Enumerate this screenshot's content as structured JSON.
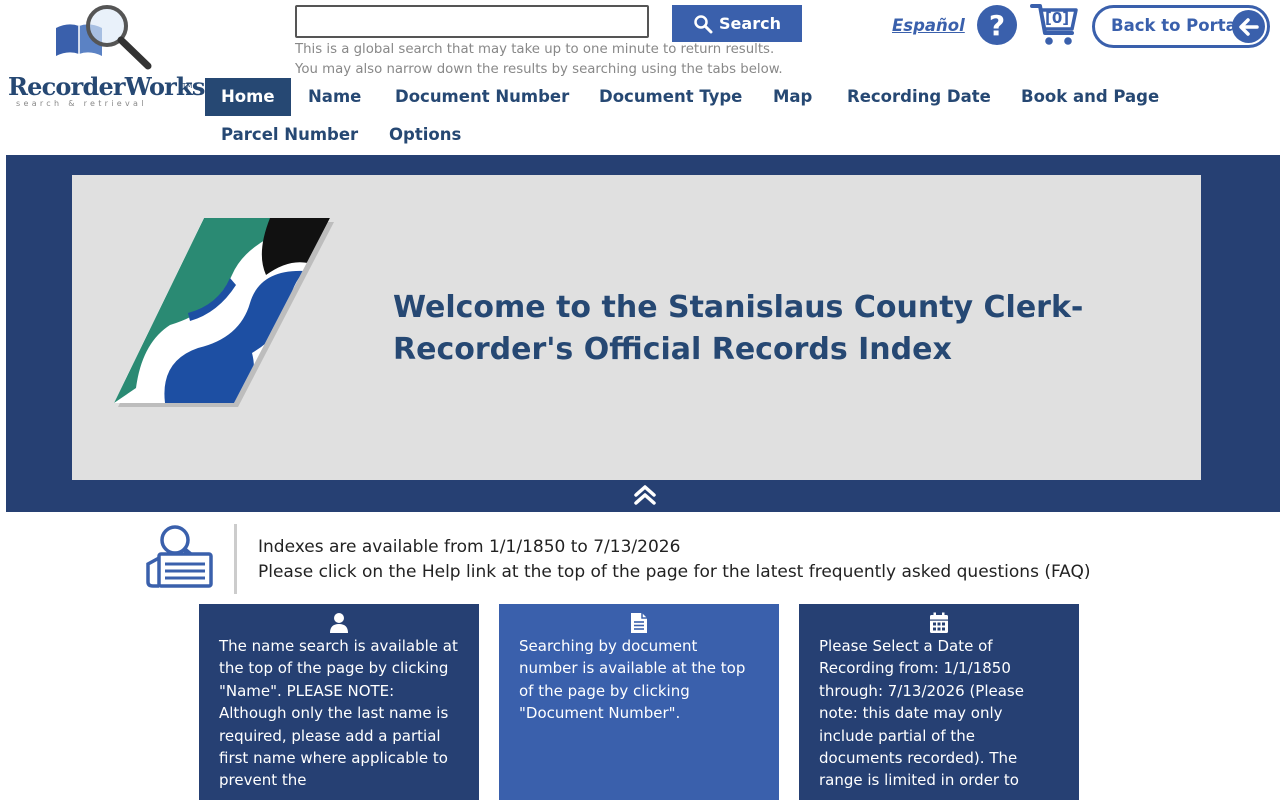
{
  "header": {
    "logo_text": "RecorderWorks",
    "logo_tm": "TM",
    "logo_tagline": "search & retrieval",
    "search_placeholder": "",
    "search_button": "Search",
    "search_hint_line1": "This is a global search that may take up to one minute to return results.",
    "search_hint_line2": "You may also narrow down the results by searching using the tabs below.",
    "language_link": "Español",
    "help_icon": "question-icon",
    "cart_count": "[0]",
    "portal_button": "Back to Portal"
  },
  "nav": {
    "items": [
      "Home",
      "Name",
      "Document Number",
      "Document Type",
      "Map",
      "Recording Date",
      "Book and Page",
      "Parcel Number",
      "Options"
    ],
    "active": "Home"
  },
  "hero": {
    "title_line1": "Welcome to the Stanislaus County Clerk-",
    "title_line2": "Recorder's Official Records Index"
  },
  "info": {
    "line1": "Indexes are available from 1/1/1850 to 7/13/2026",
    "line2": "Please click on the Help link at the top of the page for the latest frequently asked questions (FAQ)"
  },
  "cards": [
    {
      "icon": "user-icon",
      "text": "The name search is available at the top of the page by clicking \"Name\". PLEASE NOTE: Although only the last name is required, please add a partial first name where applicable to prevent the",
      "color": "#264073"
    },
    {
      "icon": "document-icon",
      "text": "Searching by document number is available at the top of the page by clicking \"Document Number\".",
      "color": "#3a60ac"
    },
    {
      "icon": "calendar-icon",
      "text": "Please Select a Date of Recording from: 1/1/1850 through: 7/13/2026 (Please note: this date may only include partial of the documents recorded). The range is limited in order to",
      "color": "#264073"
    }
  ],
  "colors": {
    "primary_dark": "#264073",
    "primary": "#3a60ac",
    "hero_panel": "#e0e0e0",
    "logo_teal": "#2a8a73",
    "logo_blue": "#1d4fa3"
  }
}
